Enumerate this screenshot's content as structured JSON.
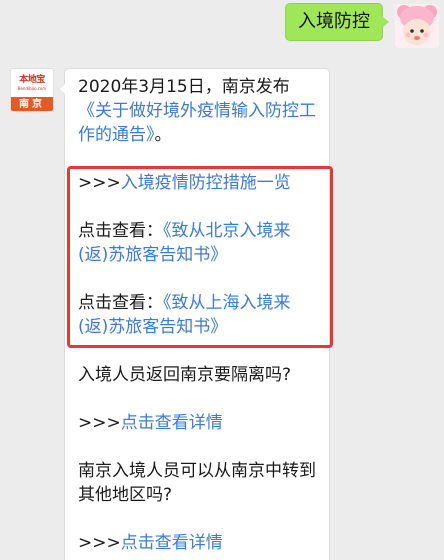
{
  "outgoing": {
    "text": "入境防控"
  },
  "incoming": {
    "logo": {
      "name": "本地宝",
      "sub": "Bendibao.com",
      "city": "南京"
    },
    "intro": {
      "prefix": "2020年3月15日，南京发布",
      "link": "《关于做好境外疫情输入防控工作的通告》",
      "suffix": "。"
    },
    "measures": {
      "arrow": ">>>",
      "link": "入境疫情防控措施一览"
    },
    "notice1": {
      "label": "点击查看：",
      "link": "《致从北京入境来(返)苏旅客告知书》"
    },
    "notice2": {
      "label": "点击查看：",
      "link": "《致从上海入境来(返)苏旅客告知书》"
    },
    "q1": {
      "question": "入境人员返回南京要隔离吗?",
      "arrow": ">>>",
      "link": "点击查看详情"
    },
    "q2": {
      "question": "南京入境人员可以从南京中转到其他地区吗?",
      "arrow": ">>>",
      "link": "点击查看详情"
    }
  },
  "colors": {
    "outgoing_bubble": "#9fe658",
    "link": "#3a7bd5",
    "highlight": "#e53935",
    "brand": "#e35a25"
  },
  "icons": {
    "user_avatar": "pink-bear-hat-baby-avatar",
    "bot_avatar": "bendibao-logo"
  }
}
